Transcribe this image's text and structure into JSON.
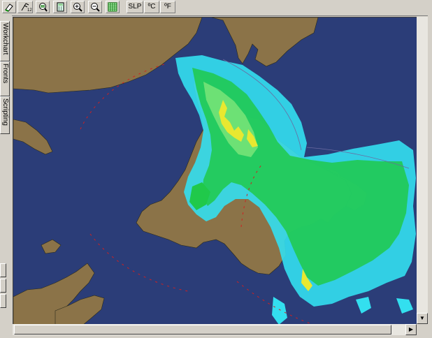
{
  "toolbar": {
    "tools": [
      {
        "name": "eraser-icon"
      },
      {
        "name": "wind-barb-icon"
      },
      {
        "name": "magnifier-icon"
      },
      {
        "name": "calculator-icon"
      },
      {
        "name": "zoom-in-icon"
      },
      {
        "name": "zoom-out-icon"
      },
      {
        "name": "grid-icon"
      }
    ],
    "slp_label": "SLP",
    "celsius_label": "ºC",
    "fahrenheit_label": "ºF"
  },
  "side_tabs": {
    "workchart": "Workchart",
    "fronts": "Fronts",
    "scripting": "Scripting"
  },
  "map": {
    "ocean_color": "#2b3d78",
    "land_color": "#8b7348",
    "radar_colors": [
      "#33dfef",
      "#20c94a",
      "#7fe67a",
      "#e8e830"
    ]
  }
}
